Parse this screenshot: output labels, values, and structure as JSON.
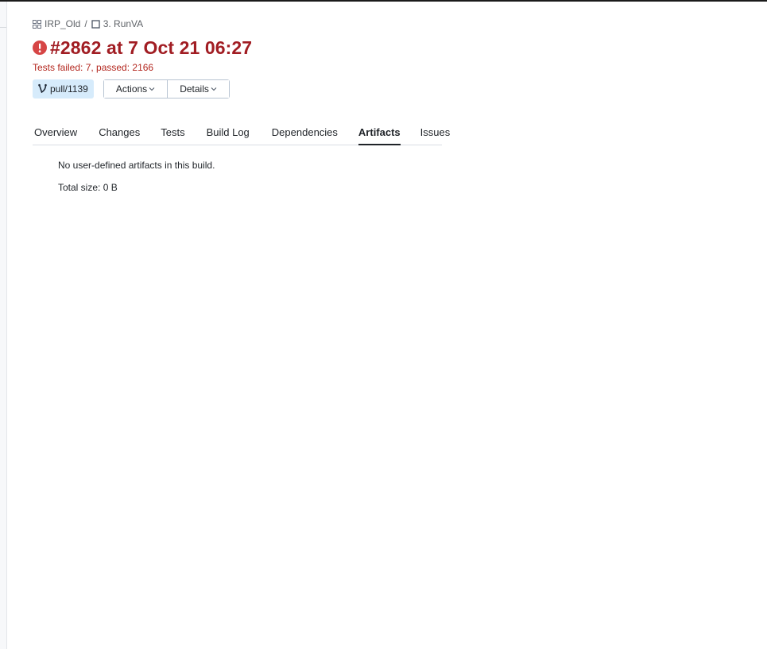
{
  "breadcrumb": {
    "project": "IRP_Old",
    "separator": "/",
    "build_config": "3. RunVA"
  },
  "build": {
    "title": "#2862 at 7 Oct 21 06:27",
    "status_text": "Tests failed: 7, passed: 2166",
    "status_icon": "error-icon",
    "status_color": "#a11d23"
  },
  "controls": {
    "branch_label": "pull/1139",
    "actions_label": "Actions",
    "details_label": "Details"
  },
  "tabs": [
    {
      "label": "Overview",
      "active": false
    },
    {
      "label": "Changes",
      "active": false
    },
    {
      "label": "Tests",
      "active": false
    },
    {
      "label": "Build Log",
      "active": false
    },
    {
      "label": "Dependencies",
      "active": false
    },
    {
      "label": "Artifacts",
      "active": true
    },
    {
      "label": "Issues",
      "active": false
    }
  ],
  "artifacts": {
    "message": "No user-defined artifacts in this build.",
    "total_size": "Total size: 0 B"
  },
  "colors": {
    "accent_error": "#a11d23",
    "branch_chip_bg": "#d6ebfb"
  }
}
